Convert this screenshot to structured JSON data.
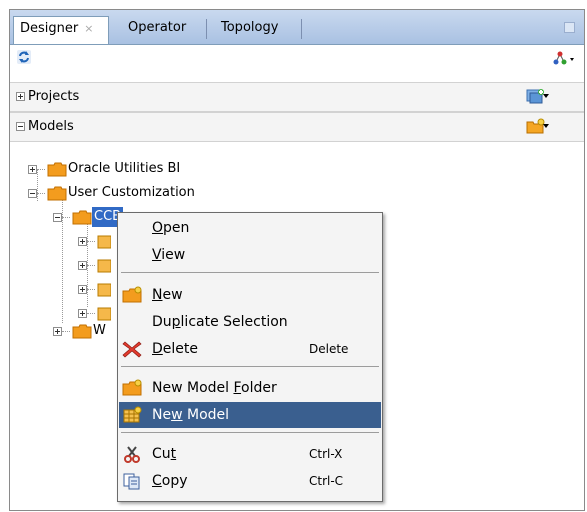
{
  "tabs": [
    {
      "label": "Designer",
      "close": "×",
      "active": true
    },
    {
      "label": "Operator",
      "active": false
    },
    {
      "label": "Topology",
      "active": false
    }
  ],
  "toolbar": {
    "refresh_icon": "refresh-icon",
    "topology_icon": "topology-icon"
  },
  "sections": {
    "projects": {
      "label": "Projects",
      "expanded": false,
      "action_icon": "new-project-icon"
    },
    "models": {
      "label": "Models",
      "expanded": true,
      "action_icon": "new-model-folder-icon"
    }
  },
  "tree": {
    "oracle_bi": "Oracle Utilities BI",
    "user_customization": "User Customization",
    "ccb": "CCB",
    "w_node": "W"
  },
  "menu": {
    "open": {
      "pre": "",
      "u": "O",
      "post": "pen"
    },
    "view": {
      "pre": "",
      "u": "V",
      "post": "iew"
    },
    "new": {
      "pre": "",
      "u": "N",
      "post": "ew"
    },
    "duplicate": {
      "pre": "Du",
      "u": "p",
      "post": "licate Selection"
    },
    "delete": {
      "pre": "",
      "u": "D",
      "post": "elete",
      "shortcut": "Delete"
    },
    "new_model_folder": {
      "pre": "New Model ",
      "u": "F",
      "post": "older"
    },
    "new_model": {
      "pre": "Ne",
      "u": "w",
      "post": " Model",
      "highlighted": true
    },
    "cut": {
      "pre": "Cu",
      "u": "t",
      "post": "",
      "shortcut": "Ctrl-X"
    },
    "copy": {
      "pre": "",
      "u": "C",
      "post": "opy",
      "shortcut": "Ctrl-C"
    }
  },
  "colors": {
    "selection": "#316ac5",
    "menu_highlight": "#3a5f8f",
    "folder": "#f39c1e"
  }
}
